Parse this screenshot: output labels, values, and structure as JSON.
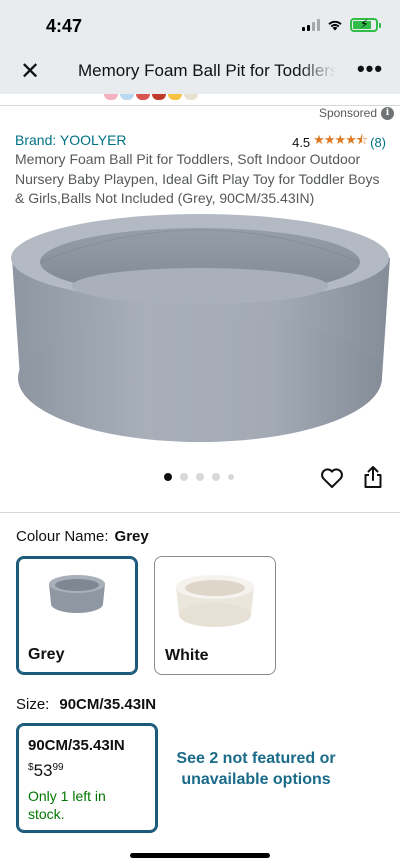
{
  "status_bar": {
    "time": "4:47"
  },
  "nav": {
    "title": "Memory Foam Ball Pit for Toddlers",
    "more_label": "•••"
  },
  "sponsored": {
    "label": "Sponsored"
  },
  "product": {
    "brand": "Brand: YOOLYER",
    "rating_value": "4.5",
    "rating_count": "(8)",
    "title": "Memory Foam Ball Pit for Toddlers, Soft Indoor Outdoor Nursery Baby Playpen, Ideal Gift Play Toy for Toddler Boys & Girls,Balls Not Included (Grey, 90CM/35.43IN)"
  },
  "carousel": {
    "count": 5,
    "active_index": 0
  },
  "colour": {
    "label": "Colour Name:",
    "selected": "Grey",
    "options": [
      {
        "name": "Grey",
        "color": "#9aa1ab"
      },
      {
        "name": "White",
        "color": "#eeeae2"
      }
    ]
  },
  "size": {
    "label": "Size:",
    "selected": "90CM/35.43IN",
    "option": {
      "name": "90CM/35.43IN",
      "currency": "$",
      "whole": "53",
      "fraction": "99",
      "stock": "Only 1 left in stock."
    },
    "unavailable_link": "See 2 not featured or unavailable options"
  },
  "colors": {
    "link": "#007185",
    "star": "#de7921",
    "selected_border": "#1b5a7a",
    "stock": "#007600"
  }
}
